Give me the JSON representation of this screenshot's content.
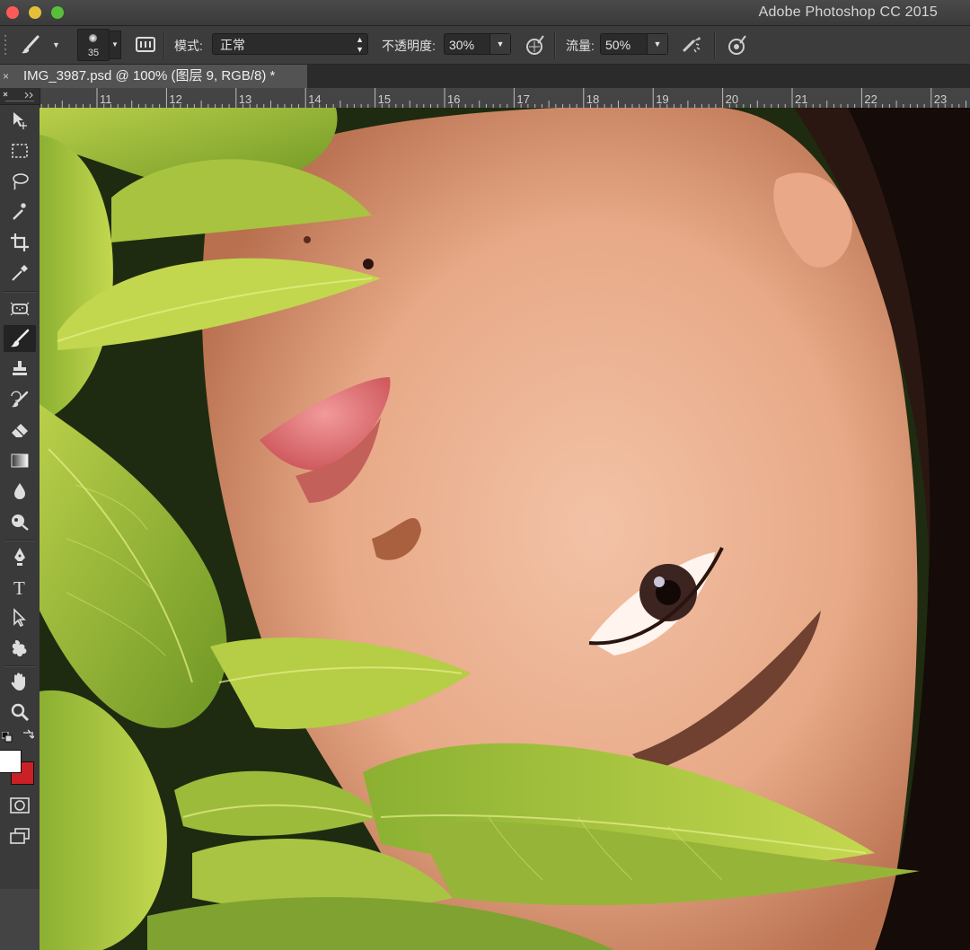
{
  "app": {
    "title": "Adobe Photoshop CC 2015"
  },
  "options_bar": {
    "brush_size": "35",
    "mode_label": "模式:",
    "mode_value": "正常",
    "opacity_label": "不透明度:",
    "opacity_value": "30%",
    "flow_label": "流量:",
    "flow_value": "50%"
  },
  "document": {
    "tab_title": "IMG_3987.psd @ 100% (图层 9, RGB/8) *",
    "tab_close": "×"
  },
  "ruler": {
    "ticks": [
      "11",
      "12",
      "13",
      "14",
      "15",
      "16",
      "17",
      "18",
      "19",
      "20",
      "21",
      "22",
      "23"
    ]
  },
  "toolbox": {
    "tools": [
      {
        "name": "move-tool-icon"
      },
      {
        "name": "marquee-tool-icon"
      },
      {
        "name": "lasso-tool-icon"
      },
      {
        "name": "magic-wand-tool-icon"
      },
      {
        "name": "crop-tool-icon"
      },
      {
        "name": "eyedropper-tool-icon"
      },
      {
        "name": "spot-healing-tool-icon"
      },
      {
        "name": "brush-tool-icon"
      },
      {
        "name": "clone-stamp-tool-icon"
      },
      {
        "name": "history-brush-tool-icon"
      },
      {
        "name": "eraser-tool-icon"
      },
      {
        "name": "gradient-tool-icon"
      },
      {
        "name": "blur-tool-icon"
      },
      {
        "name": "dodge-tool-icon"
      },
      {
        "name": "pen-tool-icon"
      },
      {
        "name": "type-tool-icon",
        "glyph": "T"
      },
      {
        "name": "path-selection-tool-icon"
      },
      {
        "name": "custom-shape-tool-icon"
      },
      {
        "name": "hand-tool-icon"
      },
      {
        "name": "zoom-tool-icon"
      }
    ],
    "active_tool": "brush-tool-icon",
    "foreground_color": "#ffffff",
    "background_color": "#cc2027"
  }
}
